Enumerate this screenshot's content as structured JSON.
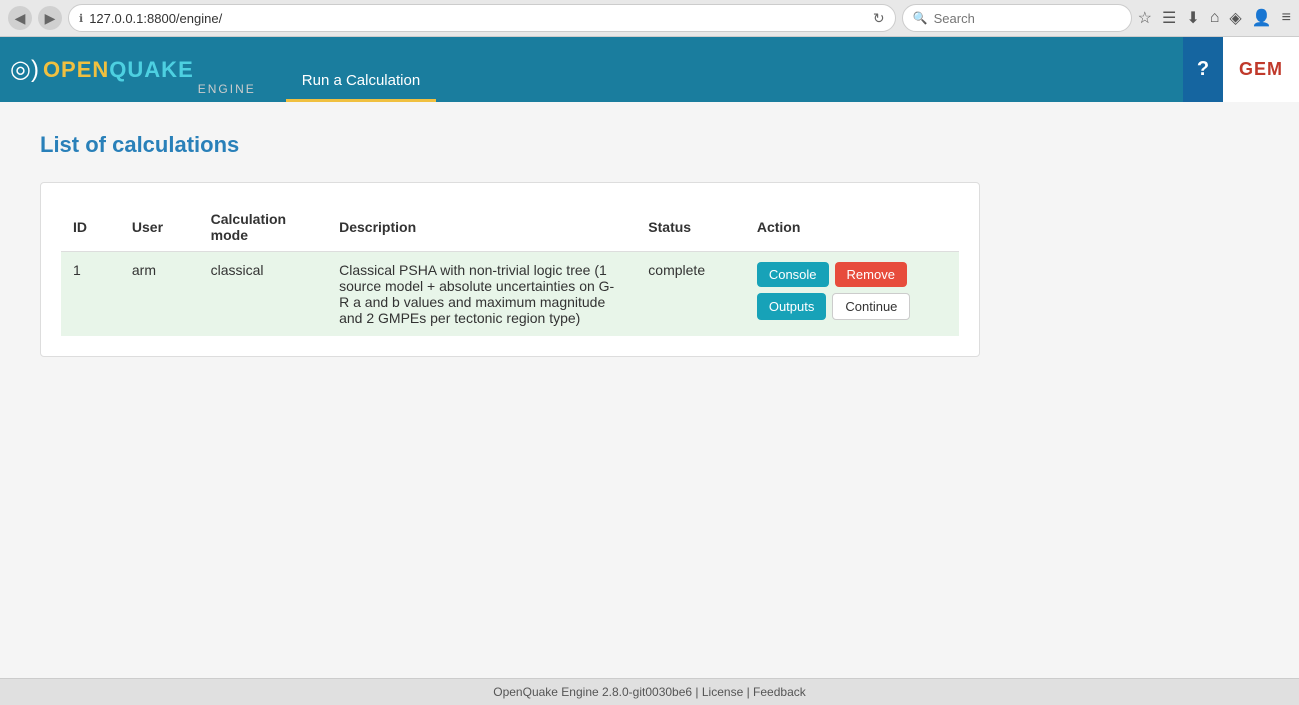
{
  "browser": {
    "back_icon": "◀",
    "forward_icon": "▶",
    "reload_icon": "↻",
    "url": "127.0.0.1:8800/engine/",
    "url_protocol": "127.0.0.1:8800/engine/",
    "search_placeholder": "Search",
    "bookmark_icon": "☆",
    "downloads_icon": "⬇",
    "home_icon": "⌂",
    "pocket_icon": "◈",
    "accounts_icon": "☰",
    "menu_icon": "≡"
  },
  "header": {
    "logo_wave": "◎",
    "logo_main": "OPENQUAKE",
    "logo_engine": "ENGINE",
    "nav_tab_label": "Run a Calculation",
    "help_label": "?",
    "gem_label": "GEM"
  },
  "main": {
    "page_title": "List of calculations",
    "table": {
      "columns": [
        "ID",
        "User",
        "Calculation mode",
        "Description",
        "Status",
        "Action"
      ],
      "rows": [
        {
          "id": "1",
          "user": "arm",
          "mode": "classical",
          "description": "Classical PSHA with non-trivial logic tree (1 source model + absolute uncertainties on G-R a and b values and maximum magnitude and 2 GMPEs per tectonic region type)",
          "status": "complete"
        }
      ]
    },
    "buttons": {
      "console": "Console",
      "remove": "Remove",
      "outputs": "Outputs",
      "continue": "Continue"
    }
  },
  "footer": {
    "text": "OpenQuake Engine 2.8.0-git0030be6",
    "separator1": " | ",
    "license_label": "License",
    "separator2": " | ",
    "feedback_label": "Feedback"
  }
}
